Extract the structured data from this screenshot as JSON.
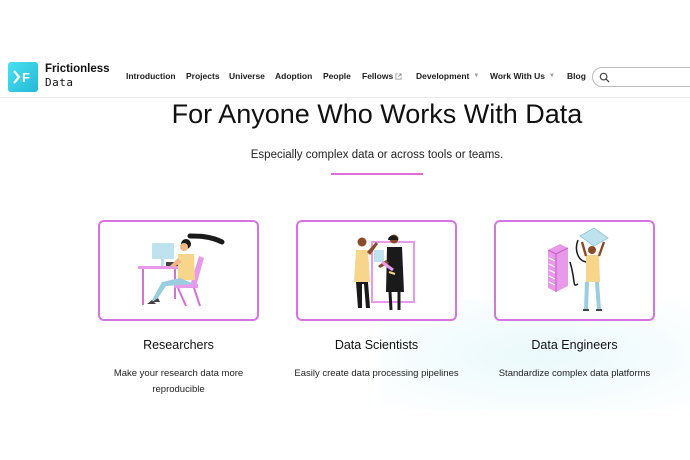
{
  "header": {
    "brand_line1": "Frictionless",
    "brand_line2": "Data",
    "logo_letter": "F",
    "nav": [
      {
        "label": "Introduction"
      },
      {
        "label": "Projects"
      },
      {
        "label": "Universe"
      },
      {
        "label": "Adoption"
      },
      {
        "label": "People"
      },
      {
        "label": "Fellows",
        "icon": "external-link-icon"
      },
      {
        "label": "Development",
        "icon": "chevron-down-icon"
      },
      {
        "label": "Work With Us",
        "icon": "chevron-down-icon"
      },
      {
        "label": "Blog"
      }
    ],
    "search_icon": "search-icon"
  },
  "hero": {
    "title": "For Anyone Who Works With Data",
    "subtitle": "Especially complex data or across tools or teams."
  },
  "audiences": [
    {
      "title": "Researchers",
      "desc_line1": "Make your research data more",
      "desc_line2": "reproducible",
      "illustration": "researcher-illustration"
    },
    {
      "title": "Data Scientists",
      "desc_line1": "Easily create data processing pipelines",
      "desc_line2": "",
      "illustration": "data-scientists-illustration"
    },
    {
      "title": "Data Engineers",
      "desc_line1": "Standardize complex data platforms",
      "desc_line2": "",
      "illustration": "data-engineer-illustration"
    }
  ],
  "colors": {
    "accent": "#d774e3",
    "logo": "#23b8d6"
  }
}
